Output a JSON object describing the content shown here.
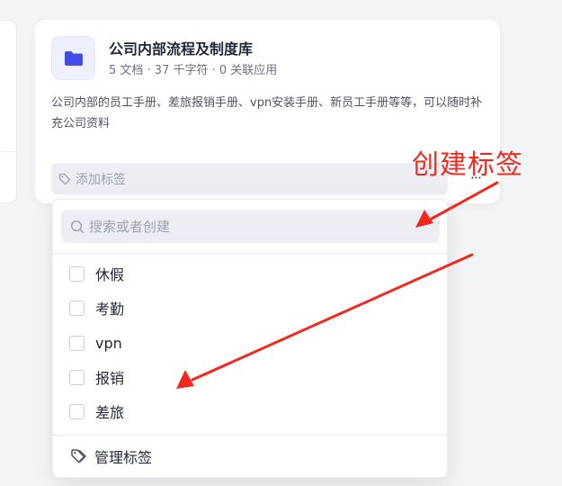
{
  "knowledge_base": {
    "title": "公司内部流程及制度库",
    "meta": "5 文档 · 37 千字符 · 0 关联应用",
    "description": "公司内部的员工手册、差旅报销手册、vpn安装手册、新员工手册等等，可以随时补充公司资料",
    "tag_placeholder": "添加标签",
    "more_label": "···"
  },
  "tag_dropdown": {
    "search_placeholder": "搜索或者创建",
    "options": [
      {
        "label": "休假",
        "checked": false
      },
      {
        "label": "考勤",
        "checked": false
      },
      {
        "label": "vpn",
        "checked": false
      },
      {
        "label": "报销",
        "checked": false
      },
      {
        "label": "差旅",
        "checked": false
      }
    ],
    "manage_label": "管理标签"
  },
  "annotation": {
    "label": "创建标签",
    "color": "#ee2a20"
  },
  "icons": {
    "folder": "folder-icon",
    "tag": "tag-icon",
    "search": "search-icon",
    "manage_tags": "tags-icon"
  },
  "colors": {
    "accent": "#444ce7",
    "accent_bg": "#eef0ff",
    "input_bg": "#eceef3"
  }
}
